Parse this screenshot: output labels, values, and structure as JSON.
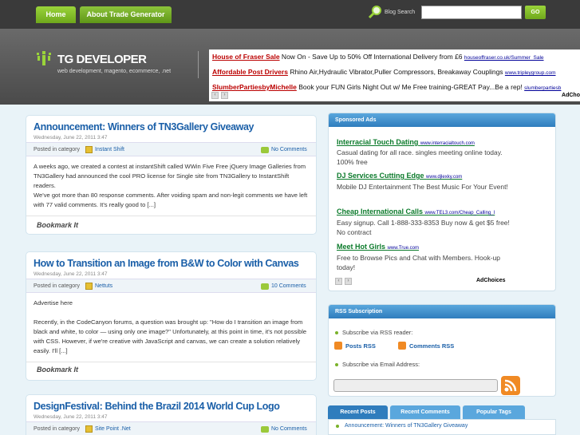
{
  "nav": {
    "home": "Home",
    "about": "About Trade Generator"
  },
  "search": {
    "label": "Blog Search",
    "button": "GO",
    "value": ""
  },
  "header": {
    "title": "TG DEVELOPER",
    "tagline": "web development, magento, ecommerce, .net"
  },
  "top_ads": [
    {
      "title": "House of Fraser Sale",
      "text": " Now On - Save Up to 50% Off International Delivery from £6 ",
      "url": "houseoffraser.co.uk/Summer_Sale"
    },
    {
      "title": "Affordable Post Drivers",
      "text": " Rhino Air,Hydraulic Vibrator,Puller Compressors, Breakaway Couplings ",
      "url": "www.tripleygroup.com"
    },
    {
      "title": "SlumberPartiesbyMichelle",
      "text": " Book your FUN Girls Night Out w/ Me Free training-GREAT Pay...Be a rep! ",
      "url": "slumberpartiesb"
    }
  ],
  "top_adchoices": "AdCho",
  "posts": [
    {
      "title": "Announcement: Winners of TN3Gallery Giveaway",
      "date": "Wednesday, June 22, 2011 3:47",
      "meta_label": "Posted in category",
      "category": "Instant Shift",
      "comments": "No Comments",
      "body": "A weeks ago, we created a contest at instantShift called WWin Five Free jQuery Image Galleries from TN3Gallery had announced the cool PRO license for Single site from TN3Gallery to InstantShift readers.\nWe've got more than 80 response comments. After voiding spam and non-legit comments we have left with 77 valid comments. It's really good to [...]",
      "bookmark": "Bookmark It"
    },
    {
      "title": "How to Transition an Image from B&W to Color with Canvas",
      "date": "Wednesday, June 22, 2011 3:47",
      "meta_label": "Posted in category",
      "category": "Nettuts",
      "comments": "10 Comments",
      "body": "Advertise here\n\nRecently, in the CodeCanyon forums, a question was brought up: \"How do I transition an image from black and white, to color — using only one image?\" Unfortunately, at this point in time, it's not possible with CSS. However, if we're creative with JavaScript and canvas, we can create a solution relatively easily. I'll [...]",
      "bookmark": "Bookmark It"
    },
    {
      "title": "DesignFestival: Behind the Brazil 2014 World Cup Logo",
      "date": "Wednesday, June 22, 2011 3:47",
      "meta_label": "Posted in category",
      "category": "Site Point .Net",
      "comments": "No Comments"
    }
  ],
  "sponsored": {
    "heading": "Sponsored Ads",
    "ads": [
      {
        "title": "Interracial Touch Dating",
        "url": "www.interracialtouch.com",
        "desc": "Casual dating for all race. singles meeting online today. 100% free"
      },
      {
        "title": "DJ Services Cutting Edge",
        "url": "www.djlexky.com",
        "desc": "Mobile DJ Entertainment The Best Music For Your Event!"
      },
      {
        "title": "Cheap International Calls",
        "url": "www.TEL3.com/Cheap_Calling_I",
        "desc": "Easy signup. Call 1-888-333-8353 Buy now & get $5 free! No contract"
      },
      {
        "title": "Meet Hot Girls",
        "url": "www.True.com",
        "desc": "Free to Browse Pics and Chat with Members. Hook-up today!"
      }
    ],
    "adchoices": "AdChoices"
  },
  "rss": {
    "heading": "RSS Subscription",
    "reader_text": "Subscribe via RSS reader:",
    "posts_link": "Posts RSS",
    "comments_link": "Comments RSS",
    "email_text": "Subscribe via Email Address:"
  },
  "tabs": {
    "recent": "Recent Posts",
    "comments": "Recent Comments",
    "popular": "Popular Tags"
  },
  "recent_item": "Announcement: Winners of TN3Gallery Giveaway"
}
